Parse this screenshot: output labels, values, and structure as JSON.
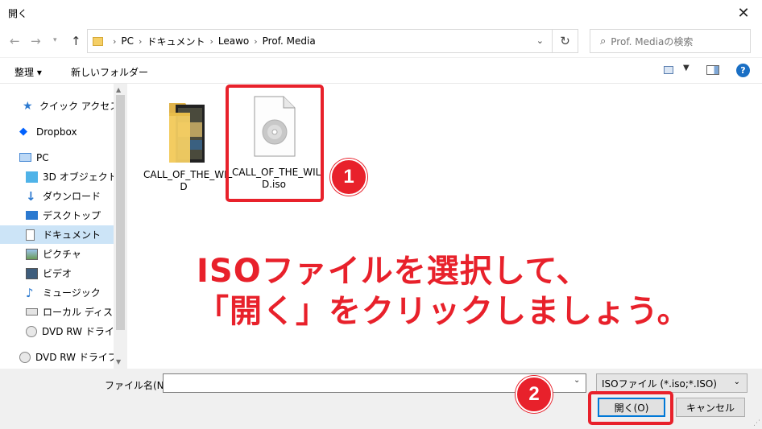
{
  "window": {
    "title": "開く"
  },
  "address": {
    "crumbs": [
      "PC",
      "ドキュメント",
      "Leawo",
      "Prof. Media"
    ]
  },
  "search": {
    "placeholder": "Prof. Mediaの検索"
  },
  "toolbar": {
    "organize": "整理 ▾",
    "new_folder": "新しいフォルダー"
  },
  "sidebar": {
    "items": [
      {
        "label": "クイック アクセス",
        "icon": "star-icon"
      },
      {
        "label": "Dropbox",
        "icon": "dropbox-icon"
      },
      {
        "label": "PC",
        "icon": "pc-icon"
      },
      {
        "label": "3D オブジェクト",
        "icon": "cube-icon"
      },
      {
        "label": "ダウンロード",
        "icon": "download-icon"
      },
      {
        "label": "デスクトップ",
        "icon": "desktop-icon"
      },
      {
        "label": "ドキュメント",
        "icon": "document-icon"
      },
      {
        "label": "ピクチャ",
        "icon": "picture-icon"
      },
      {
        "label": "ビデオ",
        "icon": "video-icon"
      },
      {
        "label": "ミュージック",
        "icon": "music-icon"
      },
      {
        "label": "ローカル ディスク (C",
        "icon": "disk-icon"
      },
      {
        "label": "DVD RW ドライブ (",
        "icon": "dvd-icon"
      },
      {
        "label": "DVD RW ドライブ (D",
        "icon": "dvd-icon"
      }
    ],
    "selected_index": 6
  },
  "files": [
    {
      "name": "CALL_OF_THE_WILD",
      "type": "folder"
    },
    {
      "name": "CALL_OF_THE_WILD.iso",
      "type": "iso"
    }
  ],
  "annotation": {
    "badge1": "1",
    "badge2": "2",
    "line1": "ISOファイルを選択して、",
    "line2": "「開く」をクリックしましょう。"
  },
  "bottom": {
    "filename_label": "ファイル名(N):",
    "filename_value": "",
    "filter": "ISOファイル (*.iso;*.ISO)",
    "open_label": "開く(O)",
    "cancel_label": "キャンセル"
  },
  "colors": {
    "accent": "#e8212b",
    "selected": "#cce4f7",
    "focus": "#0078d7"
  }
}
